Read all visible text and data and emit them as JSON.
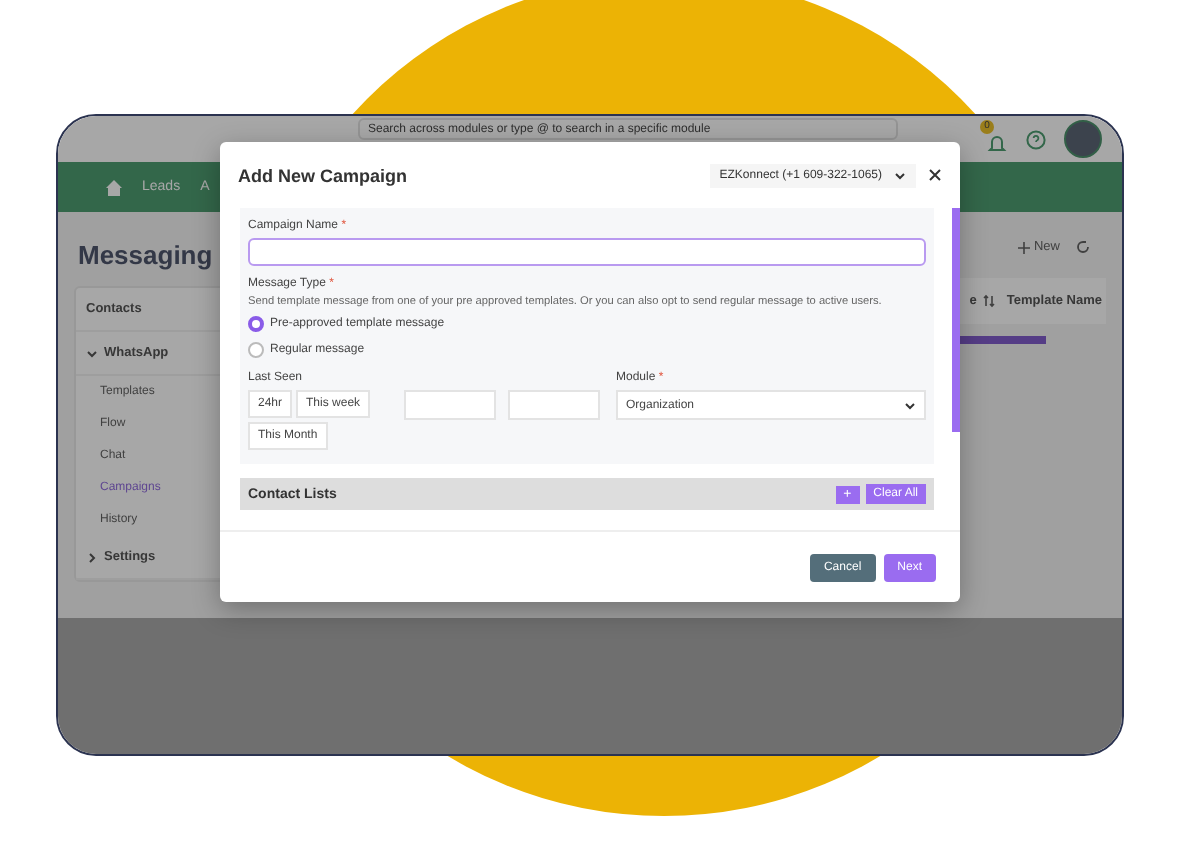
{
  "topbar": {
    "search_placeholder": "Search across modules or type @ to search in a specific module",
    "notification_count": "0"
  },
  "nav": {
    "items": [
      "Leads",
      "A"
    ]
  },
  "sidebar": {
    "title": "Messaging",
    "items": [
      {
        "label": "Contacts",
        "kind": "link"
      },
      {
        "label": "WhatsApp",
        "kind": "group",
        "expanded": true,
        "children": [
          {
            "label": "Templates",
            "selected": false
          },
          {
            "label": "Flow",
            "selected": false
          },
          {
            "label": "Chat",
            "selected": false
          },
          {
            "label": "Campaigns",
            "selected": true
          },
          {
            "label": "History",
            "selected": false
          }
        ]
      },
      {
        "label": "Settings",
        "kind": "group",
        "expanded": false
      }
    ]
  },
  "toolbar": {
    "new_button": "New"
  },
  "table": {
    "columns": [
      "e",
      "Template Name"
    ]
  },
  "modal": {
    "title": "Add New Campaign",
    "account": "EZKonnect (+1 609-322-1065)",
    "campaign_name": {
      "label": "Campaign Name",
      "required_mark": "*"
    },
    "message_type": {
      "label": "Message Type",
      "required_mark": "*",
      "description": "Send template message from one of your pre approved templates. Or you can also opt to send regular message to active users.",
      "options": [
        {
          "label": "Pre-approved template message",
          "selected": true
        },
        {
          "label": "Regular message",
          "selected": false
        }
      ]
    },
    "last_seen": {
      "label": "Last Seen",
      "options": [
        "24hr",
        "This week",
        "This Month"
      ]
    },
    "module": {
      "label": "Module",
      "required_mark": "*",
      "value": "Organization"
    },
    "contact_lists": {
      "title": "Contact Lists",
      "add_button": "+",
      "clear_button": "Clear All"
    },
    "buttons": {
      "cancel": "Cancel",
      "next": "Next"
    }
  }
}
